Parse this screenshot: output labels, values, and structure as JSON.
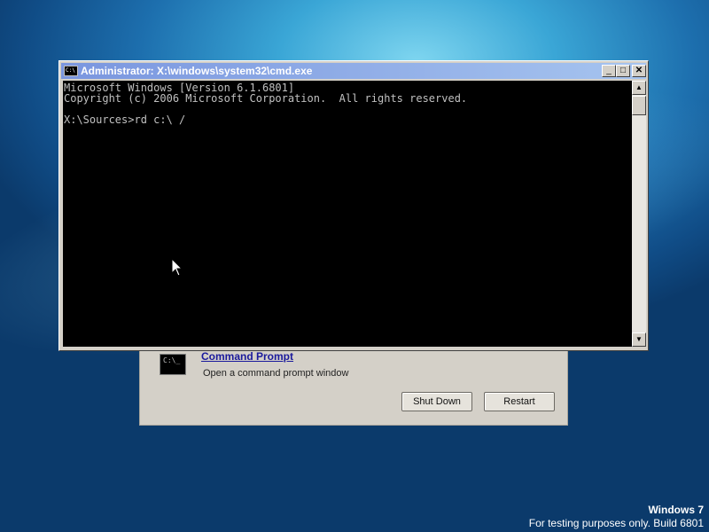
{
  "cmd_window": {
    "title": "Administrator: X:\\windows\\system32\\cmd.exe",
    "title_icon_text": "C:\\",
    "controls": {
      "minimize": "_",
      "maximize": "□",
      "close": "✕"
    },
    "console_text": "Microsoft Windows [Version 6.1.6801]\nCopyright (c) 2006 Microsoft Corporation.  All rights reserved.\n\nX:\\Sources>rd c:\\ /",
    "scroll_up_glyph": "▲",
    "scroll_down_glyph": "▼"
  },
  "recovery_dialog": {
    "icon_text": "C:\\_",
    "link_label": "Command Prompt",
    "description": "Open a command prompt window",
    "shutdown_label": "Shut Down",
    "restart_label": "Restart"
  },
  "watermark": {
    "title": "Windows 7",
    "build": "For testing purposes only. Build 6801"
  },
  "colors": {
    "console_bg": "#000000",
    "console_text": "#c0c0c0",
    "titlebar_start": "#7a96df",
    "titlebar_end": "#a6c4ef",
    "link": "#1a1a9c"
  },
  "icons": {
    "cursor": "mouse-pointer-icon",
    "cmd": "command-prompt-icon"
  }
}
